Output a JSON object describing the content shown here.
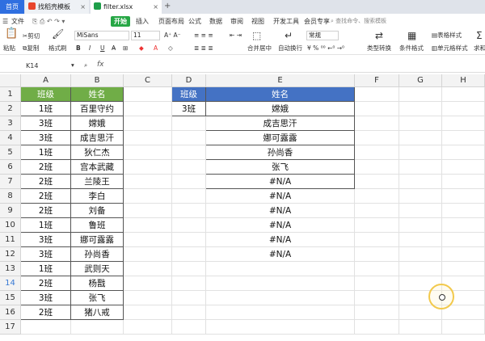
{
  "tabs": {
    "home": "首页",
    "template": "找稻壳模板",
    "file": "filter.xlsx",
    "add": "+"
  },
  "menu": {
    "file": "文件",
    "start": "开始",
    "insert": "插入",
    "layout": "页面布局",
    "formula": "公式",
    "data": "数据",
    "review": "审阅",
    "view": "视图",
    "devtools": "开发工具",
    "vip": "会员专享",
    "search": "查找命令、搜索模板"
  },
  "toolbar": {
    "paste": "粘贴",
    "cut": "剪切",
    "copy": "复制",
    "format_painter": "格式刷",
    "font_name": "MiSans",
    "font_size": "11",
    "merge_center": "合并居中",
    "wrap": "自动换行",
    "number_format": "常规",
    "type_convert": "类型转换",
    "cond_format": "条件格式",
    "table_style": "表格样式",
    "cell_style": "单元格样式",
    "sum": "求和"
  },
  "formula_bar": {
    "cell_ref": "K14",
    "fx": "fx",
    "value": ""
  },
  "columns": [
    "A",
    "B",
    "C",
    "D",
    "E",
    "F",
    "G",
    "H"
  ],
  "rows": [
    "1",
    "2",
    "3",
    "4",
    "5",
    "6",
    "7",
    "8",
    "9",
    "10",
    "11",
    "12",
    "13",
    "14",
    "15",
    "16",
    "17"
  ],
  "selected_row": "14",
  "table_left": {
    "headers": [
      "班级",
      "姓名"
    ],
    "rows": [
      [
        "1班",
        "百里守约"
      ],
      [
        "3班",
        "嫦娥"
      ],
      [
        "3班",
        "成吉思汗"
      ],
      [
        "1班",
        "狄仁杰"
      ],
      [
        "2班",
        "宫本武藏"
      ],
      [
        "2班",
        "兰陵王"
      ],
      [
        "2班",
        "李白"
      ],
      [
        "2班",
        "刘备"
      ],
      [
        "1班",
        "鲁班"
      ],
      [
        "3班",
        "娜可露露"
      ],
      [
        "3班",
        "孙尚香"
      ],
      [
        "1班",
        "武则天"
      ],
      [
        "2班",
        "杨戬"
      ],
      [
        "3班",
        "张飞"
      ],
      [
        "2班",
        "猪八戒"
      ]
    ]
  },
  "table_right": {
    "header_d": "班级",
    "header_e": "姓名",
    "criteria": "3班",
    "results": [
      "嫦娥",
      "成吉思汗",
      "娜可露露",
      "孙尚香",
      "张飞",
      "#N/A",
      "#N/A",
      "#N/A",
      "#N/A",
      "#N/A",
      "#N/A"
    ]
  },
  "colors": {
    "header_green": "#70ad47",
    "header_blue": "#4472c4",
    "accent_green": "#26a745",
    "home_tab": "#2f6fe0"
  }
}
